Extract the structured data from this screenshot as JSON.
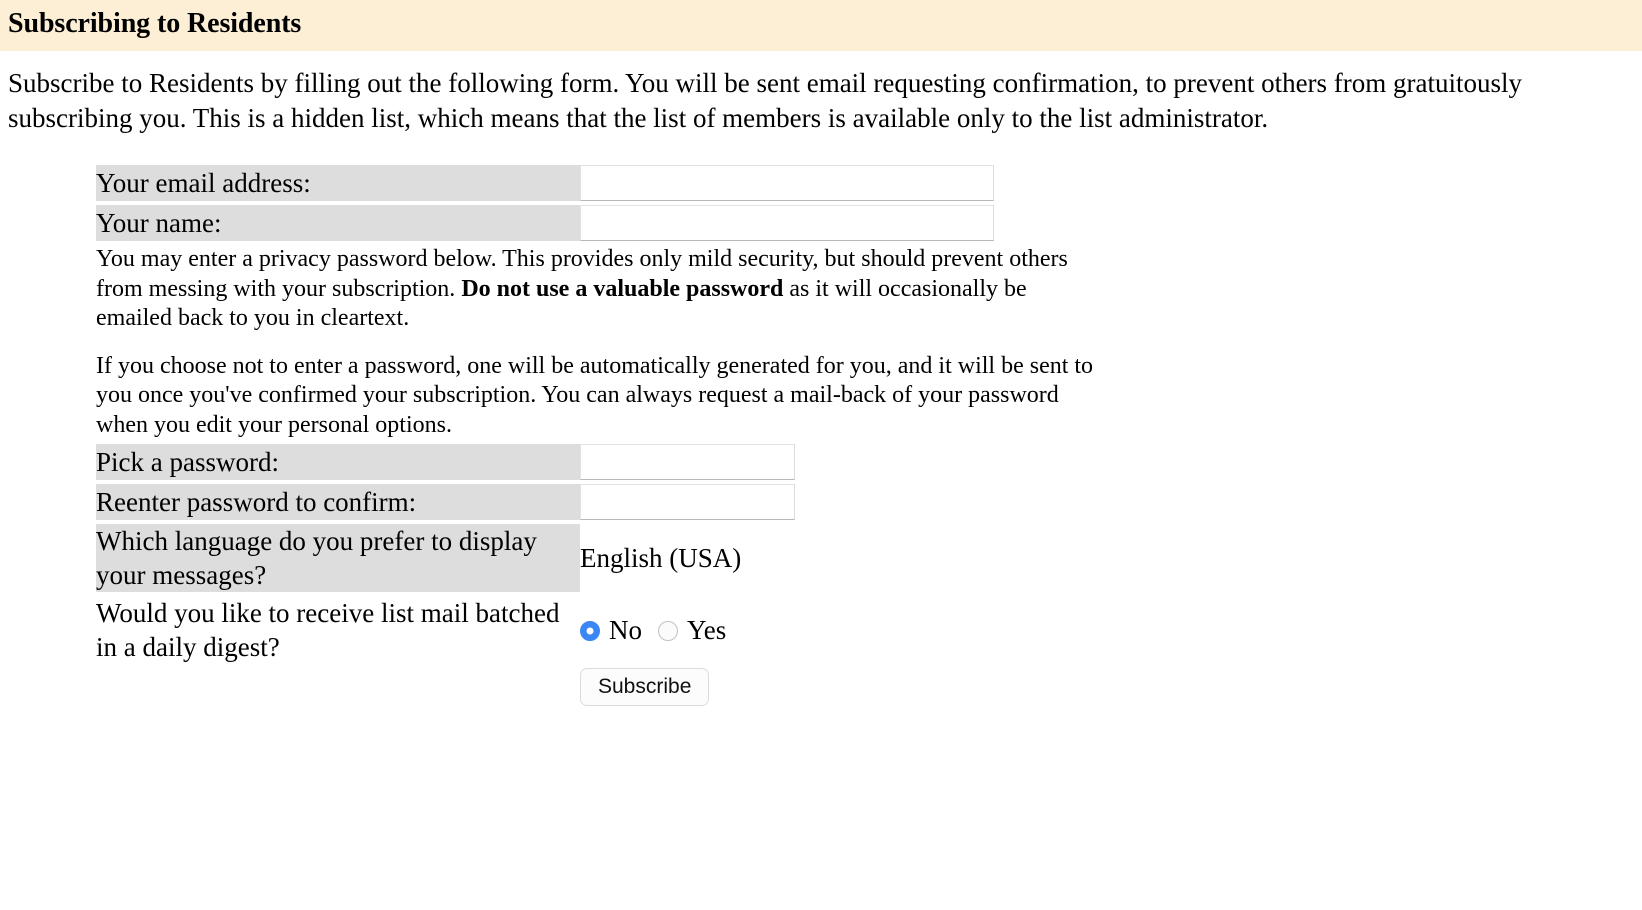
{
  "header": {
    "title": "Subscribing to Residents",
    "background_color": "#fdefd6"
  },
  "intro": {
    "text": "Subscribe to Residents by filling out the following form. You will be sent email requesting confirmation, to prevent others from gratuitously subscribing you. This is a hidden list, which means that the list of members is available only to the list administrator."
  },
  "form": {
    "fields": {
      "email": {
        "label": "Your email address:",
        "value": "",
        "placeholder": ""
      },
      "name": {
        "label": "Your name:",
        "value": "",
        "placeholder": ""
      },
      "password": {
        "label": "Pick a password:",
        "value": "",
        "placeholder": ""
      },
      "password_confirm": {
        "label": "Reenter password to confirm:",
        "value": "",
        "placeholder": ""
      },
      "language": {
        "label": "Which language do you prefer to display your messages?",
        "selected": "English (USA)",
        "options": [
          "English (USA)"
        ]
      },
      "digest": {
        "label": "Would you like to receive list mail batched in a daily digest?",
        "selected": "No",
        "options": [
          {
            "label": "No",
            "checked": true
          },
          {
            "label": "Yes",
            "checked": false
          }
        ]
      }
    },
    "notes": {
      "password_note_part1": "You may enter a privacy password below. This provides only mild security, but should prevent others from messing with your subscription. ",
      "password_note_bold": "Do not use a valuable password",
      "password_note_part2": " as it will occasionally be emailed back to you in cleartext.",
      "autogen_note": "If you choose not to enter a password, one will be automatically generated for you, and it will be sent to you once you've confirmed your subscription. You can always request a mail-back of your password when you edit your personal options."
    },
    "submit_label": "Subscribe"
  },
  "colors": {
    "header_bg": "#fdefd6",
    "label_cell_bg": "#dddddd",
    "radio_accent": "#3a86f4",
    "page_bg": "#ffffff"
  }
}
